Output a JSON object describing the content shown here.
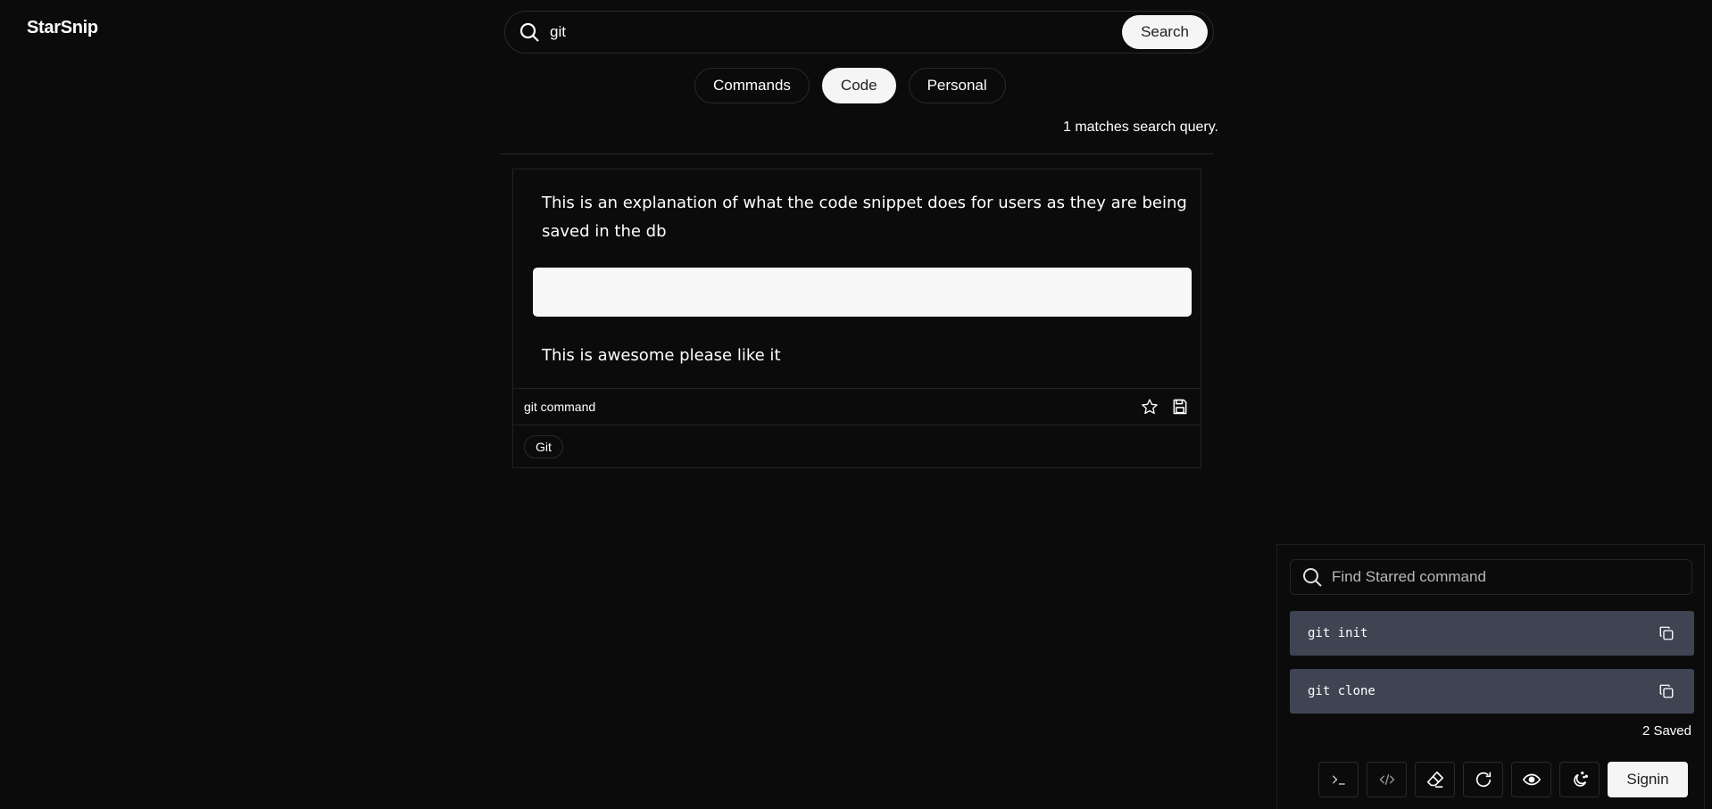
{
  "app": {
    "title": "StarSnip"
  },
  "search": {
    "query": "git",
    "button_label": "Search"
  },
  "tabs": [
    {
      "label": "Commands",
      "active": false
    },
    {
      "label": "Code",
      "active": true
    },
    {
      "label": "Personal",
      "active": false
    }
  ],
  "results": {
    "match_text": "1 matches search query."
  },
  "snippet": {
    "description": "This is an explanation of what the code snippet does for users as they are being saved in the db",
    "code": "",
    "note": "This is awesome please like it",
    "title": "git command",
    "tags": [
      "Git"
    ]
  },
  "starred_panel": {
    "search_placeholder": "Find Starred command",
    "items": [
      {
        "command": "git init"
      },
      {
        "command": "git clone"
      }
    ],
    "saved_text": "2 Saved",
    "signin_label": "Signin"
  },
  "icons": {
    "search": "search-icon",
    "star": "star-icon",
    "save": "save-icon",
    "copy": "copy-icon",
    "terminal": "terminal-icon",
    "code": "code-icon",
    "eraser": "eraser-icon",
    "refresh": "refresh-icon",
    "eye": "eye-icon",
    "theme": "moon-sparkle-icon"
  },
  "colors": {
    "background": "#0b0b0b",
    "starred_item_bg": "#3f4453",
    "button_light": "#f5f5f5"
  }
}
